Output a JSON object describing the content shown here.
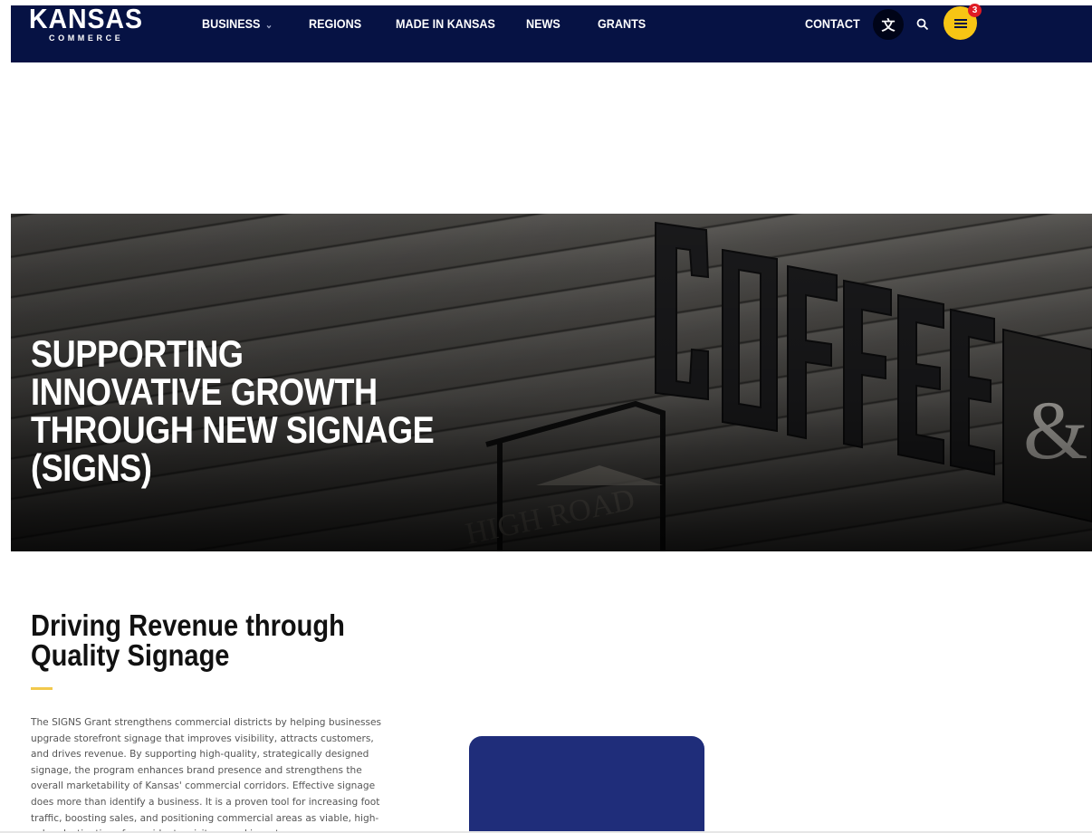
{
  "header": {
    "logo_main": "KANSAS",
    "logo_sub": "COMMERCE",
    "nav_items": [
      {
        "label": "BUSINESS",
        "has_dropdown": true
      },
      {
        "label": "REGIONS"
      },
      {
        "label": "MADE IN KANSAS"
      },
      {
        "label": "NEWS"
      },
      {
        "label": "GRANTS"
      }
    ],
    "contact_label": "CONTACT",
    "translate_icon": "translate-icon",
    "search_icon": "search-icon",
    "menu_icon": "hamburger-menu-icon",
    "menu_badge": "3",
    "colors": {
      "navbar": "#061244",
      "menu_button": "#f7c514",
      "badge": "#e01b24"
    }
  },
  "hero": {
    "title": "SUPPORTING INNOVATIVE GROWTH THROUGH NEW SIGNAGE (SIGNS)",
    "image_subject": "Storefront wall with large COFFEE & sign letters"
  },
  "content": {
    "heading": "Driving Revenue through Quality Signage",
    "accent_color": "#f2c94c",
    "body": "The SIGNS Grant strengthens commercial districts by helping businesses upgrade storefront signage that improves visibility, attracts customers, and drives revenue. By supporting high-quality, strategically designed signage, the program enhances brand presence and strengthens the overall marketability of Kansas' commercial corridors. Effective signage does more than identify a business. It is a proven tool for increasing foot traffic, boosting sales, and positioning commercial areas as viable, high-value destinations for residents, visitors, and investors.",
    "card_color": "#1f2d7a"
  }
}
